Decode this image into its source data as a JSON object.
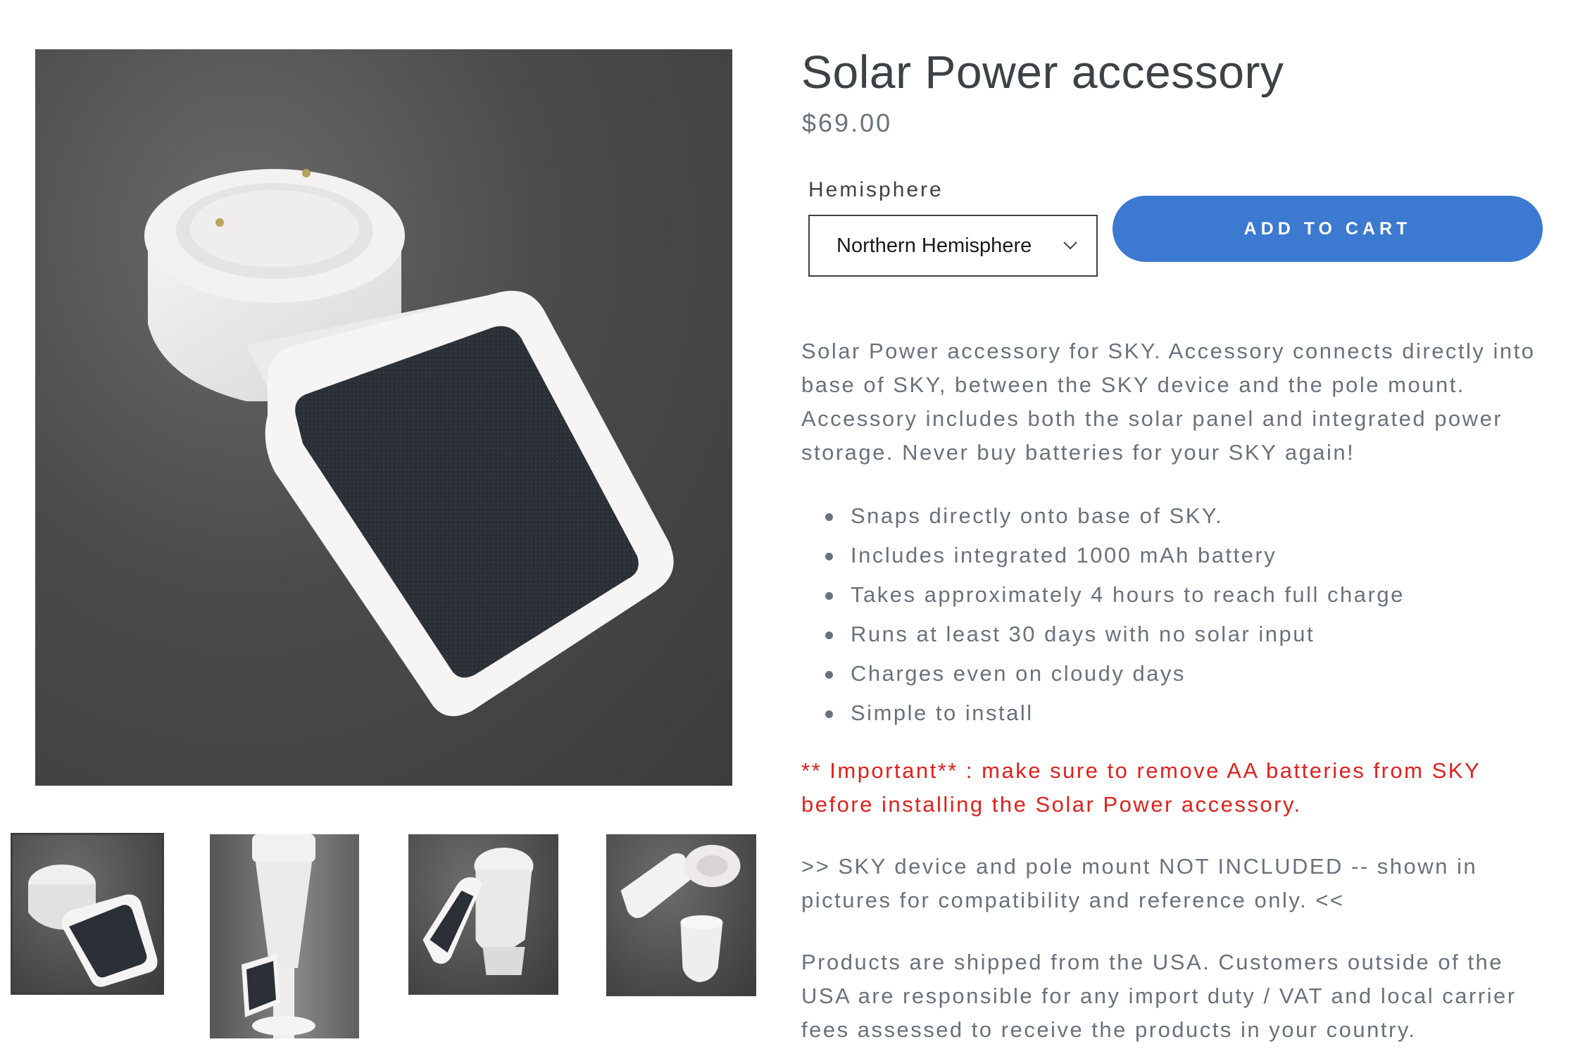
{
  "product": {
    "title": "Solar Power accessory",
    "price": "$69.00"
  },
  "gallery": {
    "main_alt": "Solar Power accessory",
    "thumbnails": [
      {
        "alt": "Solar Power accessory"
      },
      {
        "alt": "Solar Power accessory mounted on SKY"
      },
      {
        "alt": "Solar Power accessory with SKY base"
      },
      {
        "alt": "Solar Power accessory parts"
      }
    ]
  },
  "variant": {
    "label": "Hemisphere",
    "selected": "Northern Hemisphere"
  },
  "actions": {
    "add_to_cart": "ADD TO CART"
  },
  "description": {
    "intro": "Solar Power accessory for SKY. Accessory connects directly into base of SKY, between the SKY device and the pole mount. Accessory includes both the solar panel and integrated power storage. Never buy batteries for your SKY again!",
    "features": [
      "Snaps directly onto base of SKY.",
      "Includes integrated 1000 mAh battery",
      "Takes approximately 4 hours to reach full charge",
      "Runs at least 30 days with no solar input",
      "Charges even on cloudy days",
      "Simple to install"
    ],
    "warning": "** Important** : make sure to remove AA batteries from SKY before installing the Solar Power accessory.",
    "not_included": ">> SKY device and pole mount NOT INCLUDED -- shown in pictures for compatibility and reference only. <<",
    "shipping": "Products are shipped from the USA. Customers outside of the USA are responsible for any import duty / VAT and local carrier fees assessed to receive the products in your country."
  },
  "colors": {
    "accent": "#3c79d1",
    "warning": "#e0201c",
    "body_text": "#69727b",
    "heading": "#3d4246"
  }
}
